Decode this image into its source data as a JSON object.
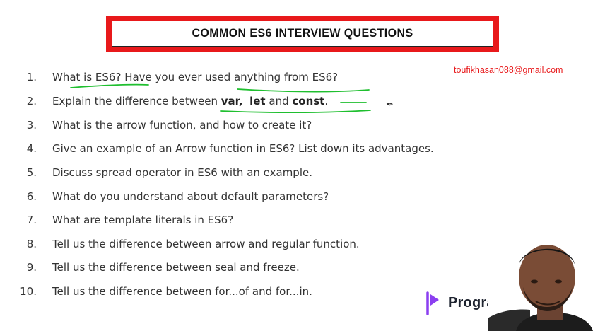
{
  "slide": {
    "title": "COMMON ES6 INTERVIEW QUESTIONS",
    "email": "toufikhasan088@gmail.com"
  },
  "questions": [
    {
      "num": "1.",
      "text": "What is ES6? Have you ever used anything from ES6?"
    },
    {
      "num": "2.",
      "pre": "Explain the difference between ",
      "k1": "var,",
      "k2": "let",
      "mid": " and ",
      "k3": "const",
      "post": "."
    },
    {
      "num": "3.",
      "text": "What is the arrow function, and how to create it?"
    },
    {
      "num": "4.",
      "text": "Give an example of an Arrow function in ES6? List down its advantages."
    },
    {
      "num": "5.",
      "text": "Discuss spread operator in ES6 with an example."
    },
    {
      "num": "6.",
      "text": "What do you understand about default parameters?"
    },
    {
      "num": "7.",
      "text": "What are template literals in ES6?"
    },
    {
      "num": "8.",
      "text": "Tell us the difference between arrow and regular function."
    },
    {
      "num": "9.",
      "text": "Tell us the difference between seal and freeze."
    },
    {
      "num": "10.",
      "text": "Tell us the difference between for...of and for...in."
    }
  ],
  "logo": {
    "text": "Programmi"
  },
  "colors": {
    "accent_red": "#e8191b",
    "annotation_green": "#1fbf2f",
    "logo_purple": "#8b3ff0"
  }
}
